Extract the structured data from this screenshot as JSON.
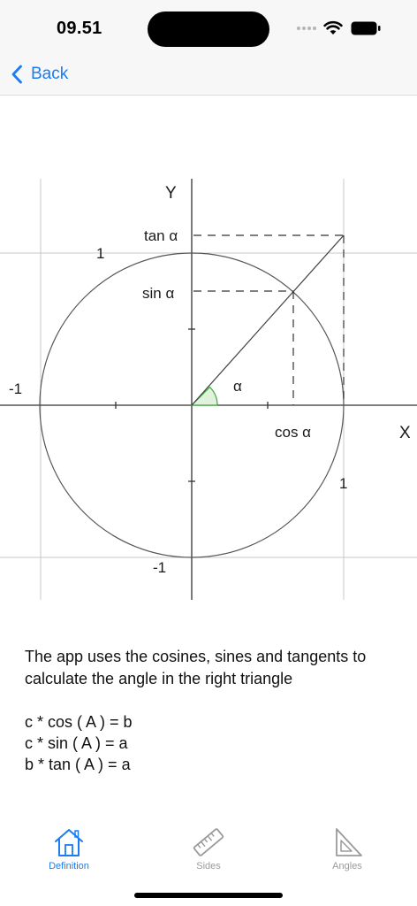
{
  "status_bar": {
    "time": "09.51"
  },
  "nav": {
    "back_label": "Back"
  },
  "diagram": {
    "y_axis": "Y",
    "x_axis": "X",
    "tan_label": "tan α",
    "sin_label": "sin α",
    "cos_label": "cos α",
    "alpha_label": "α",
    "one_top": "1",
    "one_right": "1",
    "minus_one_left": "-1",
    "minus_one_bottom": "-1"
  },
  "description": "The app uses the cosines, sines and tangents to calculate the angle in the right triangle",
  "formulas": [
    "c * cos ( A ) = b",
    "c * sin ( A ) = a",
    "b * tan ( A ) = a"
  ],
  "tabs": [
    {
      "label": "Definition",
      "icon": "house-icon",
      "active": true
    },
    {
      "label": "Sides",
      "icon": "ruler-icon",
      "active": false
    },
    {
      "label": "Angles",
      "icon": "set-square-icon",
      "active": false
    }
  ],
  "colors": {
    "accent": "#1a7cf5",
    "inactive": "#9a9a9a",
    "angle_fill": "#dff2dc",
    "angle_stroke": "#3aa83a"
  }
}
